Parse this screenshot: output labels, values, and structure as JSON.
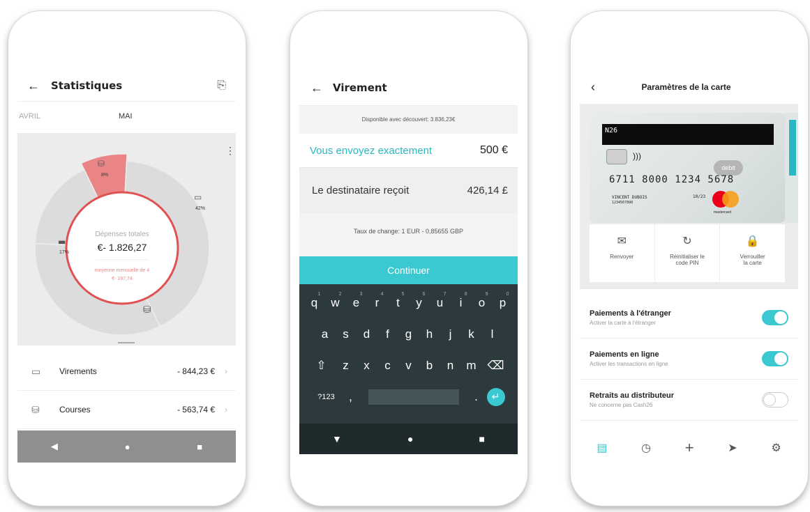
{
  "colors": {
    "teal": "#3ac9d0",
    "salmon": "#e98585",
    "red": "#e05252",
    "keyboard": "#2c3a3e"
  },
  "phone1": {
    "title": "Statistiques",
    "back_icon": "←",
    "doc_icon": "⎘",
    "months": [
      "AVRIL",
      "MAI"
    ],
    "more_icon": "⋮",
    "donut": {
      "center_label": "Dépenses totales",
      "center_value": "€- 1.826,27",
      "center_sub_1": "moyenne mensuelle de 4",
      "center_sub_2": "€- 197,74",
      "segments": [
        {
          "label": "8%",
          "share": 8,
          "color": "#e98585"
        },
        {
          "label": "42%",
          "share": 42,
          "color": "#dcdcdc"
        },
        {
          "label": "",
          "share": 33,
          "color": "#dcdcdc"
        },
        {
          "label": "17%",
          "share": 17,
          "color": "#dcdcdc"
        }
      ]
    },
    "rows": [
      {
        "icon": "transfer-icon",
        "label": "Virements",
        "value": "- 844,23 €"
      },
      {
        "icon": "shopping-icon",
        "label": "Courses",
        "value": "- 563,74 €"
      }
    ],
    "chevron": "›",
    "nav": [
      "◀",
      "●",
      "■"
    ]
  },
  "phone2": {
    "title": "Virement",
    "back_icon": "←",
    "available": "Disponible avec découvert: 3.836,23€",
    "send_label": "Vous envoyez exactement",
    "send_value": "500 €",
    "recv_label": "Le destinataire reçoit",
    "recv_value": "426,14 £",
    "rate": "Taux de change: 1 EUR - 0,85655 GBP",
    "continue": "Continuer",
    "keys_row1": [
      "q",
      "w",
      "e",
      "r",
      "t",
      "y",
      "u",
      "i",
      "o",
      "p"
    ],
    "keys_row1_nums": [
      "1",
      "2",
      "3",
      "4",
      "5",
      "6",
      "7",
      "8",
      "9",
      "0"
    ],
    "keys_row2": [
      "a",
      "s",
      "d",
      "f",
      "g",
      "h",
      "j",
      "k",
      "l"
    ],
    "keys_row3": [
      "z",
      "x",
      "c",
      "v",
      "b",
      "n",
      "m"
    ],
    "shift": "⇧",
    "backspace": "⌫",
    "numbers": "?123",
    "comma": ",",
    "period": ".",
    "enter": "↵",
    "nav": [
      "▼",
      "●",
      "■"
    ]
  },
  "phone3": {
    "title": "Paramètres de la carte",
    "back_icon": "‹",
    "card": {
      "brand": "N26",
      "number": "6711 8000 1234 5678",
      "holder": "VINCENT DUBOIS",
      "holder_sub": "1234567890",
      "expiry": "10/23",
      "type": "debit",
      "network": "mastercard"
    },
    "actions": [
      {
        "icon": "mail-icon",
        "glyph": "✉",
        "label1": "Renvoyer",
        "label2": ""
      },
      {
        "icon": "refresh-icon",
        "glyph": "↻",
        "label1": "Réinitialiser le",
        "label2": "code PIN"
      },
      {
        "icon": "lock-icon",
        "glyph": "🔒",
        "label1": "Verrouiller",
        "label2": "la carte"
      }
    ],
    "settings": [
      {
        "title": "Paiements à l'étranger",
        "sub": "Activer la carte à l'étranger",
        "on": true
      },
      {
        "title": "Paiements en ligne",
        "sub": "Activer les transactions en ligne",
        "on": true
      },
      {
        "title": "Retraits au distributeur",
        "sub": "Ne concerne pas Cash26",
        "on": false
      }
    ],
    "tabs": [
      "▤",
      "◷",
      "+",
      "➤",
      "⚙"
    ]
  }
}
